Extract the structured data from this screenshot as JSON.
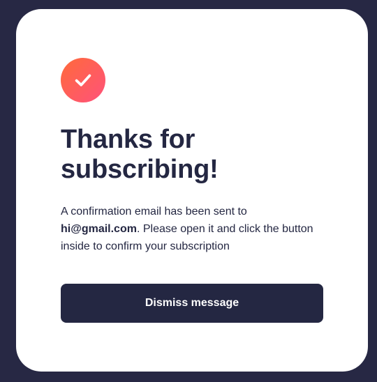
{
  "dialog": {
    "icon": "checkmark-icon",
    "title_line_1": "Thanks for",
    "title_line_2": "subscribing!",
    "message_before": "A confirmation email has been sent to",
    "email": "hi@gmail.com",
    "message_after": ". Please open it and click the button inside to confirm your subscription",
    "dismiss_label": "Dismiss message"
  },
  "colors": {
    "background": "#272844",
    "card": "#ffffff",
    "text": "#242742",
    "button": "#242742",
    "button_text": "#ffffff",
    "icon_gradient_start": "#ff6a3a",
    "icon_gradient_end": "#ff527b"
  }
}
